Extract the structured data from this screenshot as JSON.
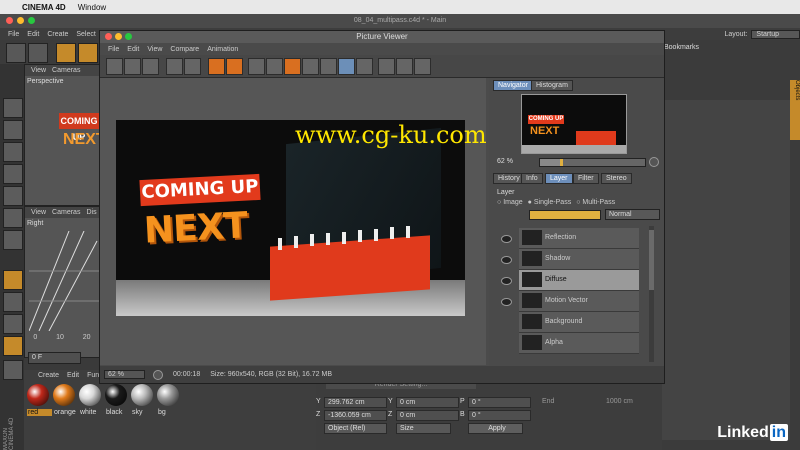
{
  "macbar": {
    "app": "CINEMA 4D",
    "window": "Window"
  },
  "app_title": "08_04_multipass.c4d * - Main",
  "c4d_menu": [
    "File",
    "Edit",
    "Create",
    "Select"
  ],
  "layout": {
    "label": "Layout:",
    "value": "Startup"
  },
  "right_panel": {
    "bookmarks": "Bookmarks",
    "objects_tab": "Objects"
  },
  "viewports": {
    "top": {
      "menu": [
        "View",
        "Cameras"
      ],
      "label": "Perspective"
    },
    "bottom": {
      "menu": [
        "View",
        "Cameras",
        "Dis"
      ],
      "label": "Right"
    }
  },
  "timeline": {
    "ticks": [
      "0",
      "10",
      "20"
    ],
    "frame": "0 F"
  },
  "materials": {
    "menu": [
      "Create",
      "Edit",
      "Fun"
    ],
    "items": [
      {
        "label": "red",
        "color": "#c0281a"
      },
      {
        "label": "orange",
        "color": "#e07a1a"
      },
      {
        "label": "white",
        "color": "#d8d8d8"
      },
      {
        "label": "black",
        "color": "#1a1a1a"
      },
      {
        "label": "sky",
        "color": "#bbbbbb"
      },
      {
        "label": "bg",
        "color": "#9a9a9a"
      }
    ]
  },
  "render_settings": "Render Setting...",
  "coords": {
    "rows": [
      {
        "axis": "Y",
        "pos": "299.762 cm",
        "size": "0 cm",
        "rot_axis": "P",
        "rot": "0 °"
      },
      {
        "axis": "Z",
        "pos": "-1360.059 cm",
        "size": "0 cm",
        "rot_axis": "B",
        "rot": "0 °"
      }
    ],
    "mode": "Object (Rel)",
    "size_mode": "Size",
    "apply": "Apply",
    "end_label": "End",
    "end_value": "1000 cm"
  },
  "picture_viewer": {
    "title": "Picture Viewer",
    "menu": [
      "File",
      "Edit",
      "View",
      "Compare",
      "Animation"
    ],
    "render": {
      "coming": "COMING UP",
      "next": "NEXT"
    },
    "watermark": "www.cg-ku.com",
    "status": {
      "zoom": "62 %",
      "time": "00:00:18",
      "info": "Size: 960x540, RGB (32 Bit), 16.72 MB"
    },
    "nav_tabs": [
      "Navigator",
      "Histogram"
    ],
    "nav_zoom": "62 %",
    "tabs": [
      "History",
      "Info",
      "Layer",
      "Filter",
      "Stereo"
    ],
    "layer_heading": "Layer",
    "modes": [
      "Image",
      "Single-Pass",
      "Multi-Pass"
    ],
    "blend": "Normal",
    "layers": [
      "Reflection",
      "Shadow",
      "Diffuse",
      "Motion Vector",
      "Background",
      "Alpha"
    ],
    "selected_layer": "Diffuse"
  },
  "branding": {
    "maxon": "MAXON",
    "c4d": "CINEMA 4D",
    "linkedin": "Linked",
    "linkedin_in": "in"
  }
}
